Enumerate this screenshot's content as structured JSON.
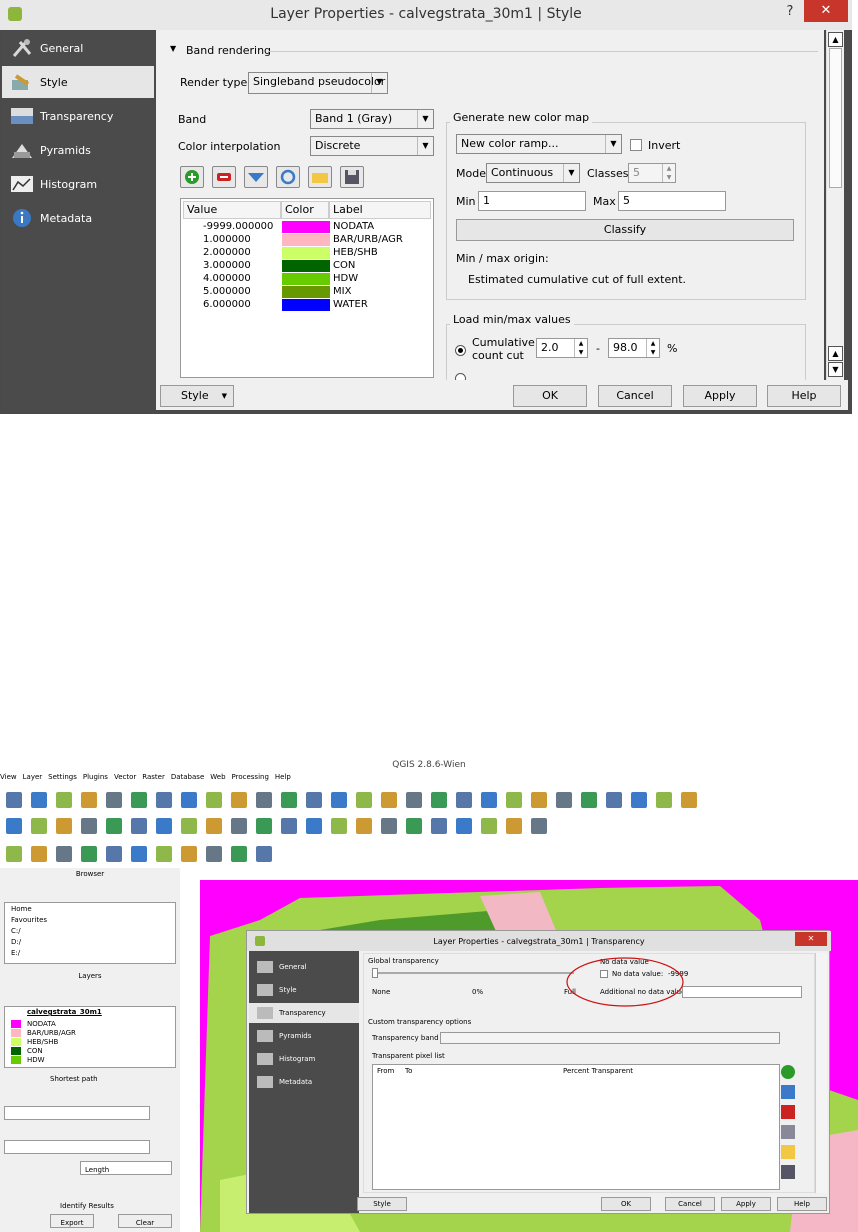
{
  "window": {
    "title": "Layer Properties - calvegstrata_30m1 | Style",
    "help": "?",
    "close": "✕"
  },
  "sidebar": {
    "items": [
      {
        "label": "General",
        "icon": "wrench-icon"
      },
      {
        "label": "Style",
        "icon": "brush-icon"
      },
      {
        "label": "Transparency",
        "icon": "transparency-icon"
      },
      {
        "label": "Pyramids",
        "icon": "pyramids-icon"
      },
      {
        "label": "Histogram",
        "icon": "histogram-icon"
      },
      {
        "label": "Metadata",
        "icon": "info-icon"
      }
    ]
  },
  "band_rendering": {
    "title": "Band rendering",
    "render_type_label": "Render type",
    "render_type_value": "Singleband pseudocolor",
    "band_label": "Band",
    "band_value": "Band 1 (Gray)",
    "interp_label": "Color interpolation",
    "interp_value": "Discrete",
    "table_headers": [
      "Value",
      "Color",
      "Label"
    ],
    "rows": [
      {
        "value": "-9999.000000",
        "color": "#ff00ff",
        "label": "NODATA"
      },
      {
        "value": "1.000000",
        "color": "#ffb6c1",
        "label": "BAR/URB/AGR"
      },
      {
        "value": "2.000000",
        "color": "#ccff66",
        "label": "HEB/SHB"
      },
      {
        "value": "3.000000",
        "color": "#006400",
        "label": "CON"
      },
      {
        "value": "4.000000",
        "color": "#66cc00",
        "label": "HDW"
      },
      {
        "value": "5.000000",
        "color": "#669900",
        "label": "MIX"
      },
      {
        "value": "6.000000",
        "color": "#0000ff",
        "label": "WATER"
      }
    ]
  },
  "colormap": {
    "title": "Generate new color map",
    "ramp_value": "New color ramp...",
    "invert_label": "Invert",
    "mode_label": "Mode",
    "mode_value": "Continuous",
    "classes_label": "Classes",
    "classes_value": "5",
    "min_label": "Min",
    "min_value": "1",
    "max_label": "Max",
    "max_value": "5",
    "classify_label": "Classify",
    "origin_label": "Min / max origin:",
    "origin_value": "Estimated cumulative cut of full extent."
  },
  "loadminmax": {
    "title": "Load min/max values",
    "cumulative_label": "Cumulative count cut",
    "low": "2.0",
    "dash": "-",
    "high": "98.0",
    "pct": "%"
  },
  "buttons": {
    "style": "Style",
    "ok": "OK",
    "cancel": "Cancel",
    "apply": "Apply",
    "help": "Help"
  },
  "shot2": {
    "app_title": "QGIS 2.8.6-Wien",
    "menus": [
      "View",
      "Layer",
      "Settings",
      "Plugins",
      "Vector",
      "Raster",
      "Database",
      "Web",
      "Processing",
      "Help"
    ],
    "browser_title": "Browser",
    "browser_items": [
      "Home",
      "Favourites",
      "C:/",
      "D:/",
      "E:/"
    ],
    "layers_title": "Layers",
    "layer_name": "calvegstrata_30m1",
    "layer_items": [
      {
        "label": "NODATA",
        "color": "#ff00ff"
      },
      {
        "label": "BAR/URB/AGR",
        "color": "#ffb6c1"
      },
      {
        "label": "HEB/SHB",
        "color": "#ccff66"
      },
      {
        "label": "CON",
        "color": "#006400"
      },
      {
        "label": "HDW",
        "color": "#66cc00"
      }
    ],
    "shortest_title": "Shortest path",
    "length_label": "Length",
    "identify_title": "Identify Results",
    "export": "Export",
    "clear": "Clear",
    "dlg_title": "Layer Properties - calvegstrata_30m1 | Transparency",
    "side": [
      "General",
      "Style",
      "Transparency",
      "Pyramids",
      "Histogram",
      "Metadata"
    ],
    "global_title": "Global transparency",
    "none": "None",
    "zero": "0%",
    "full": "Full",
    "nodata_title": "No data value",
    "nodata_label": "No data value:",
    "nodata_value": "-9999",
    "additional_nodata": "Additional no data value",
    "custom_title": "Custom transparency options",
    "band_label": "Transparency band",
    "pixel_list": "Transparent pixel list",
    "cols": [
      "From",
      "To",
      "Percent Transparent"
    ],
    "buttons": {
      "style": "Style",
      "ok": "OK",
      "cancel": "Cancel",
      "apply": "Apply",
      "help": "Help"
    }
  }
}
